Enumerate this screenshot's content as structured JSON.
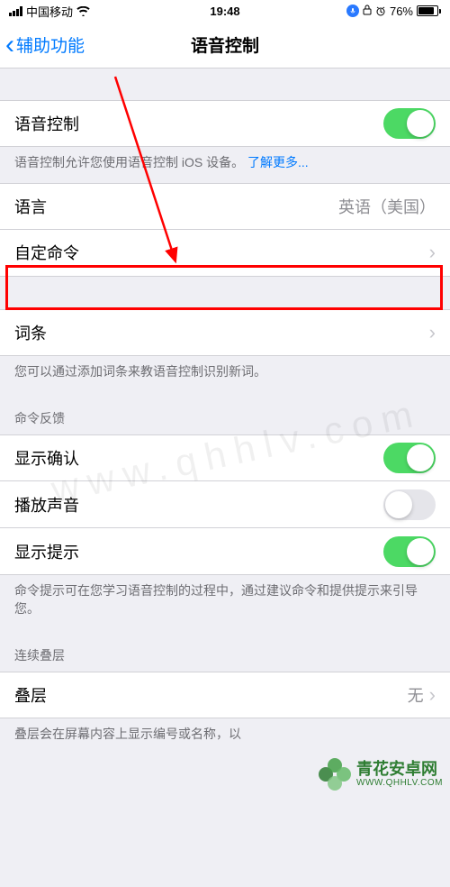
{
  "status": {
    "carrier": "中国移动",
    "time": "19:48",
    "battery_pct": "76%"
  },
  "nav": {
    "back_label": "辅助功能",
    "title": "语音控制"
  },
  "voice_control": {
    "label": "语音控制",
    "description": "语音控制允许您使用语音控制 iOS 设备。",
    "learn_more": "了解更多..."
  },
  "language": {
    "label": "语言",
    "value": "英语（美国）"
  },
  "custom_commands": {
    "label": "自定命令"
  },
  "vocabulary": {
    "label": "词条",
    "description": "您可以通过添加词条来教语音控制识别新词。"
  },
  "feedback_header": "命令反馈",
  "show_confirm": {
    "label": "显示确认"
  },
  "play_sound": {
    "label": "播放声音"
  },
  "show_hints": {
    "label": "显示提示",
    "description": "命令提示可在您学习语音控制的过程中，通过建议命令和提供提示来引导您。"
  },
  "overlay_header": "连续叠层",
  "overlay": {
    "label": "叠层",
    "value": "无",
    "description": "叠层会在屏幕内容上显示编号或名称，以"
  },
  "watermark": "www.qhhlv.com",
  "brand": {
    "name": "青花安卓网",
    "url": "WWW.QHHLV.COM"
  }
}
